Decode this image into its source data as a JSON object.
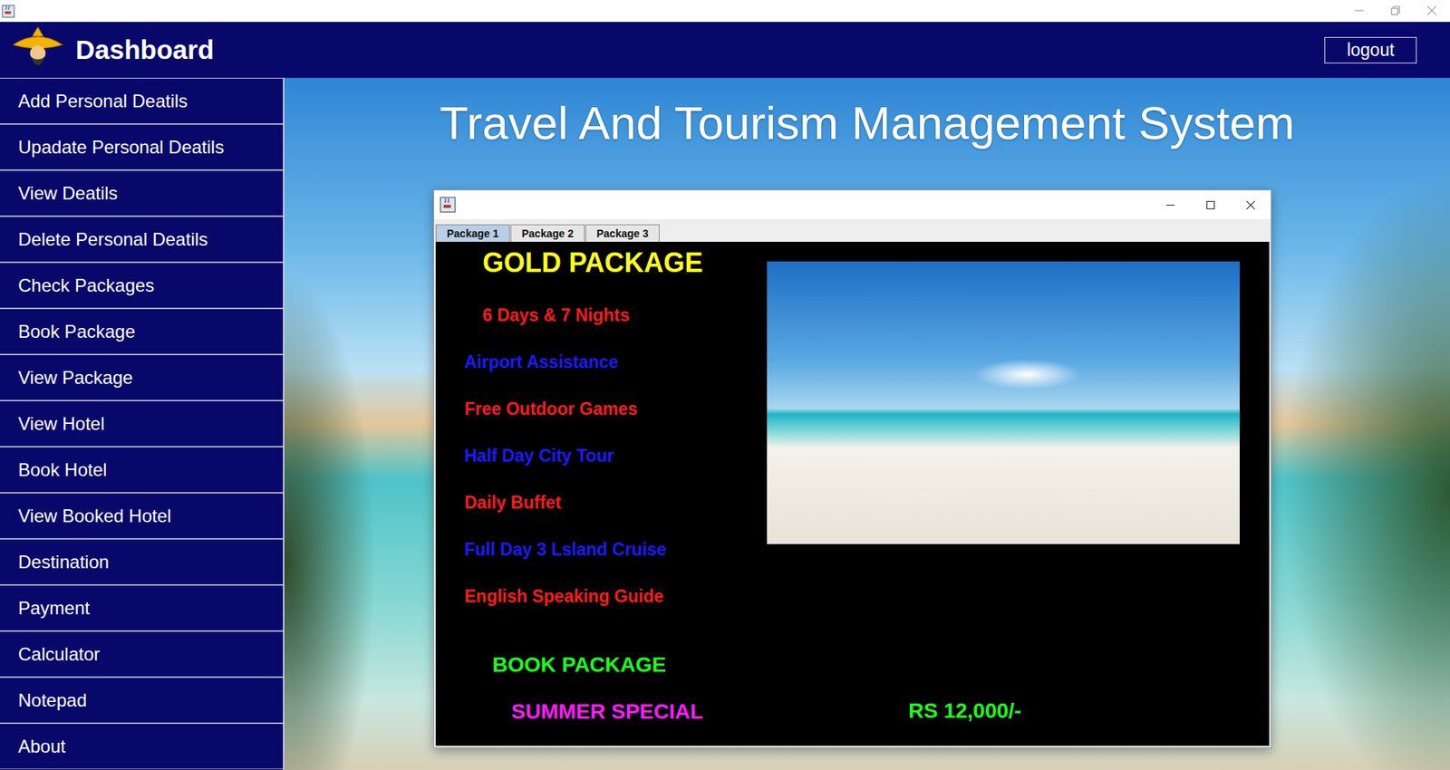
{
  "header": {
    "title": "Dashboard",
    "logout": "logout"
  },
  "sidebar": {
    "items": [
      "Add Personal Deatils",
      "Upadate Personal Deatils",
      "View Deatils",
      "Delete Personal Deatils",
      "Check Packages",
      "Book Package",
      "View Package",
      "View Hotel",
      "Book Hotel",
      "View Booked Hotel",
      "Destination",
      "Payment",
      "Calculator",
      "Notepad",
      "About"
    ]
  },
  "main": {
    "title": "Travel And Tourism Management System"
  },
  "package_window": {
    "tabs": [
      {
        "label": "Package 1",
        "selected": true
      },
      {
        "label": "Package 2",
        "selected": false
      },
      {
        "label": "Package 3",
        "selected": false
      }
    ],
    "package": {
      "name": "GOLD PACKAGE",
      "duration": "6 Days & 7 Nights",
      "features": [
        {
          "text": "Airport Assistance",
          "color": "#1a1aff"
        },
        {
          "text": "Free Outdoor Games",
          "color": "#ff1a1a"
        },
        {
          "text": "Half Day City Tour",
          "color": "#1a1aff"
        },
        {
          "text": "Daily Buffet",
          "color": "#ff1a1a"
        },
        {
          "text": "Full Day 3 Lsland Cruise",
          "color": "#1a1aff"
        },
        {
          "text": "English Speaking Guide",
          "color": "#ff1a1a"
        }
      ],
      "book": "BOOK PACKAGE",
      "offer": "SUMMER SPECIAL",
      "price": "RS 12,000/-"
    }
  }
}
